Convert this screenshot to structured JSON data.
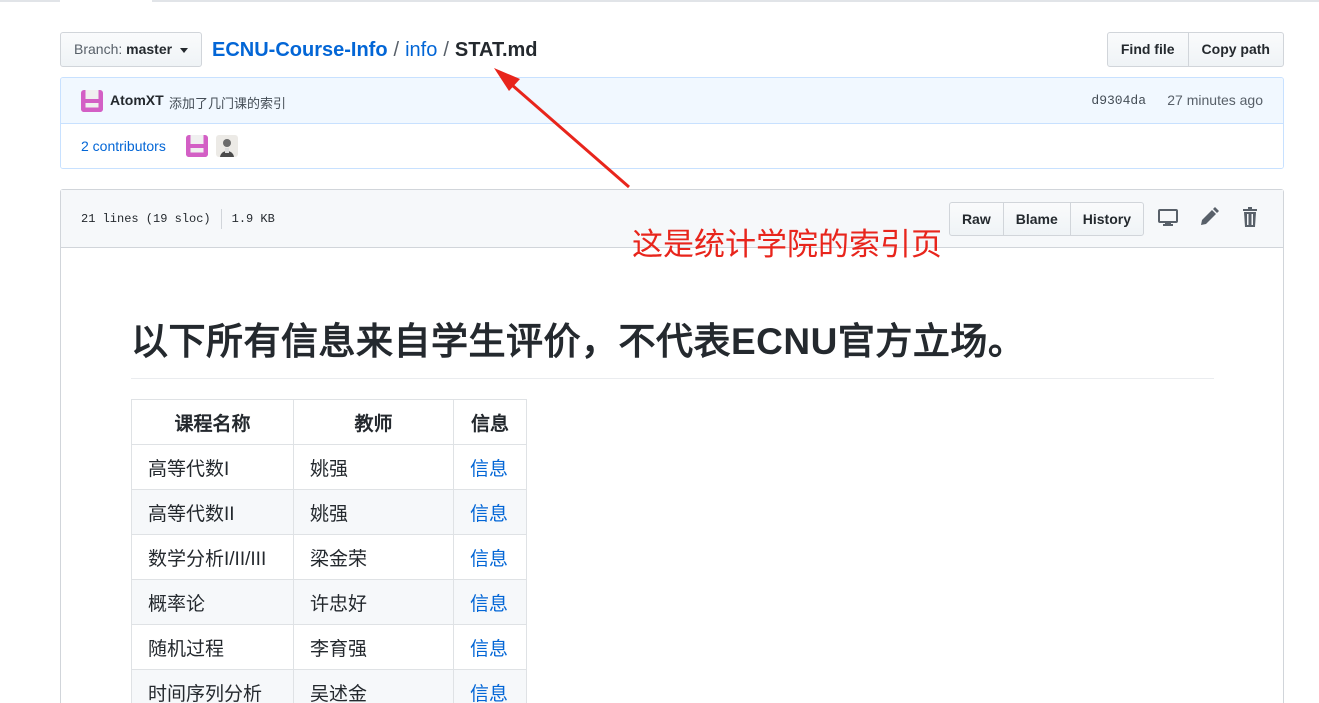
{
  "nav": {
    "branch_label": "Branch:",
    "branch_name": "master",
    "repo": "ECNU-Course-Info",
    "separator": "/",
    "folder": "info",
    "file": "STAT.md",
    "find_file": "Find file",
    "copy_path": "Copy path"
  },
  "commit": {
    "author": "AtomXT",
    "message": "添加了几门课的索引",
    "sha": "d9304da",
    "time": "27 minutes ago"
  },
  "contributors": {
    "label": "2 contributors"
  },
  "file": {
    "lines": "21 lines (19 sloc)",
    "size": "1.9 KB",
    "raw": "Raw",
    "blame": "Blame",
    "history": "History",
    "icons": [
      "desktop-icon",
      "pencil-icon",
      "trash-icon"
    ]
  },
  "content": {
    "heading": "以下所有信息来自学生评价，不代表ECNU官方立场。",
    "table": {
      "headers": [
        "课程名称",
        "教师",
        "信息"
      ],
      "rows": [
        [
          "高等代数I",
          "姚强",
          "信息"
        ],
        [
          "高等代数II",
          "姚强",
          "信息"
        ],
        [
          "数学分析I/II/III",
          "梁金荣",
          "信息"
        ],
        [
          "概率论",
          "许忠好",
          "信息"
        ],
        [
          "随机过程",
          "李育强",
          "信息"
        ],
        [
          "时间序列分析",
          "吴述金",
          "信息"
        ]
      ]
    }
  },
  "annotation": {
    "text": "这是统计学院的索引页",
    "color": "#e8251c"
  },
  "colors": {
    "link": "#0366d6",
    "commit_bg": "#f1f8ff",
    "identicon": "#d35fc5"
  }
}
